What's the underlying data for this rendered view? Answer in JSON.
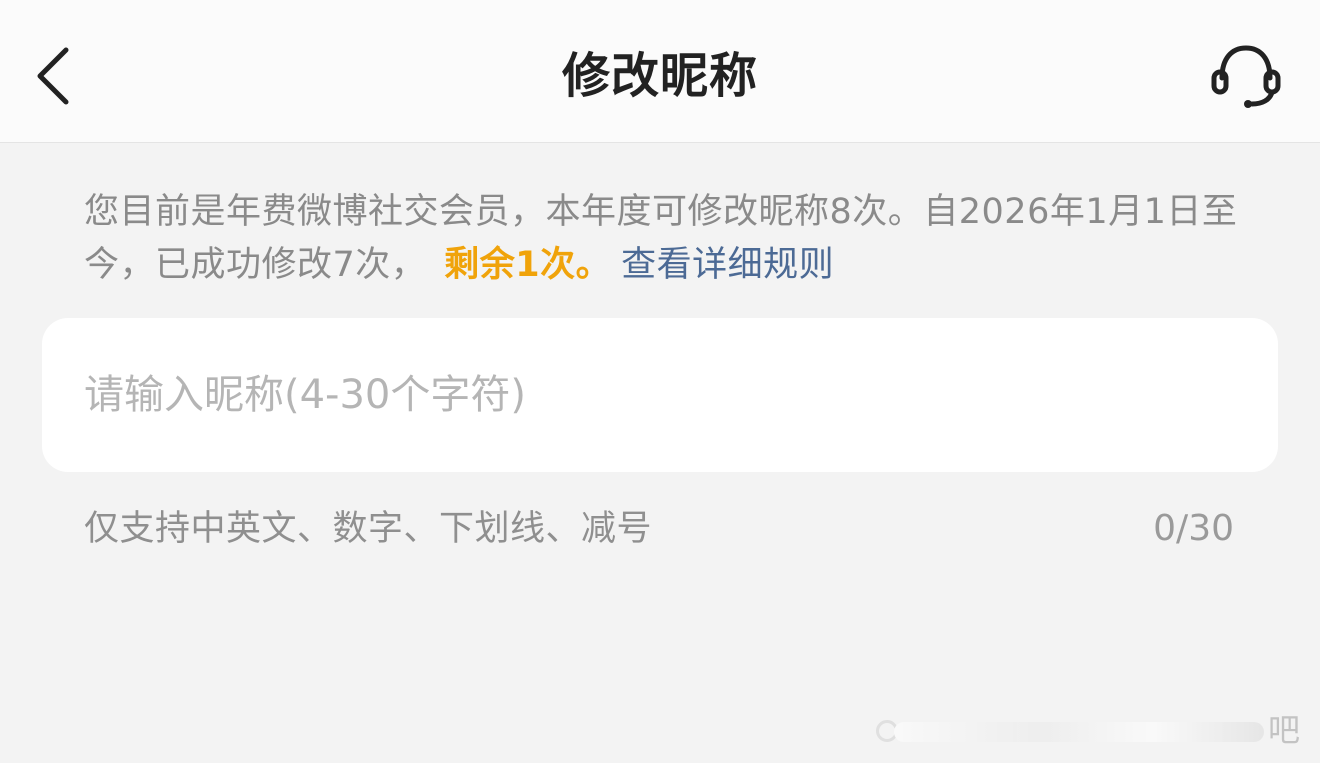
{
  "header": {
    "title": "修改昵称",
    "back_icon": "chevron-left-icon",
    "support_icon": "headset-icon"
  },
  "notice": {
    "text": "您目前是年费微博社交会员，本年度可修改昵称8次。自2026年1月1日至今，已成功修改7次，",
    "remaining": "剩余1次。",
    "rules_link": "查看详细规则",
    "remaining_color": "#f0a30a",
    "link_color": "#4c6a95"
  },
  "nickname_input": {
    "value": "",
    "placeholder": "请输入昵称(4-30个字符)"
  },
  "hint": "仅支持中英文、数字、下划线、减号",
  "counter": "0/30",
  "watermark": {
    "text": "吧"
  }
}
